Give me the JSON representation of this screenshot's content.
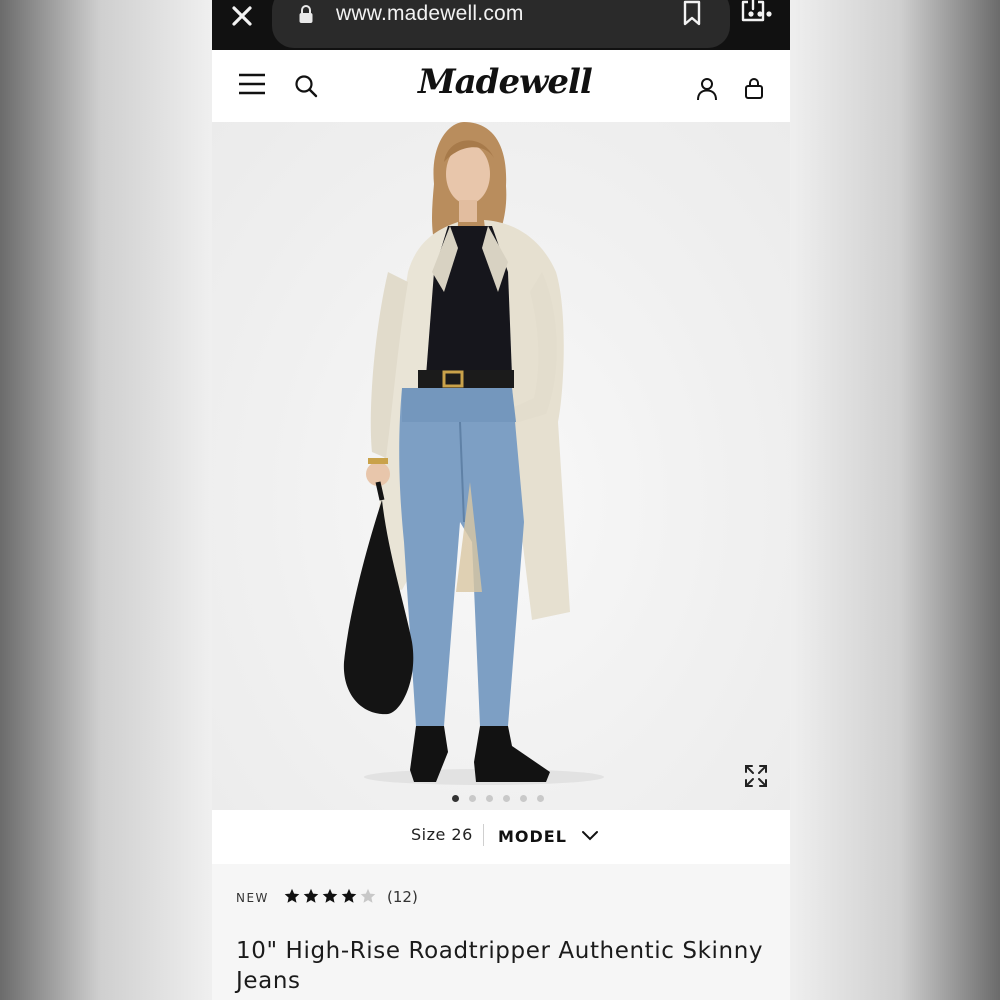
{
  "browser": {
    "url": "www.madewell.com"
  },
  "header": {
    "logo_text": "Madewell"
  },
  "product_image": {
    "carousel_total": 6,
    "carousel_active_index": 0
  },
  "size_strip": {
    "size_label": "Size 26",
    "model_label": "MODEL"
  },
  "product": {
    "badge": "NEW",
    "rating": 4,
    "rating_max": 5,
    "review_count": "(12)",
    "title": "10\" High-Rise Roadtripper Authentic Skinny Jeans"
  },
  "colors": {
    "browser_bg": "#111111",
    "url_pill": "#2a2a2a",
    "page_bg": "#f6f6f6",
    "text": "#1b1b1b",
    "star": "#111111",
    "star_empty": "#c8c8c8"
  },
  "icons": [
    "close-icon",
    "lock-icon",
    "bookmark-icon",
    "share-icon",
    "more-icon",
    "menu-icon",
    "search-icon",
    "account-icon",
    "bag-icon",
    "expand-icon",
    "chevron-down-icon",
    "star-icon"
  ]
}
